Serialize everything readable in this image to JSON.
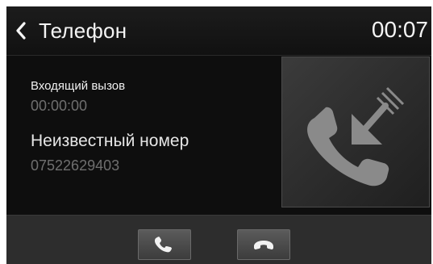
{
  "header": {
    "back_icon": "chevron-left-icon",
    "title": "Телефон",
    "clock": "00:07"
  },
  "call": {
    "status_label": "Входящий вызов",
    "duration": "00:00:00",
    "caller_name": "Неизвестный номер",
    "caller_number": "07522629403",
    "photo_icon": "incoming-call-icon"
  },
  "actions": {
    "answer_icon": "phone-answer-icon",
    "reject_icon": "phone-hangup-icon"
  },
  "colors": {
    "background": "#0e0e0e",
    "text_primary": "#f0f0f0",
    "text_secondary": "#6f6f6f",
    "bottom_bar": "#2d2d2d"
  }
}
